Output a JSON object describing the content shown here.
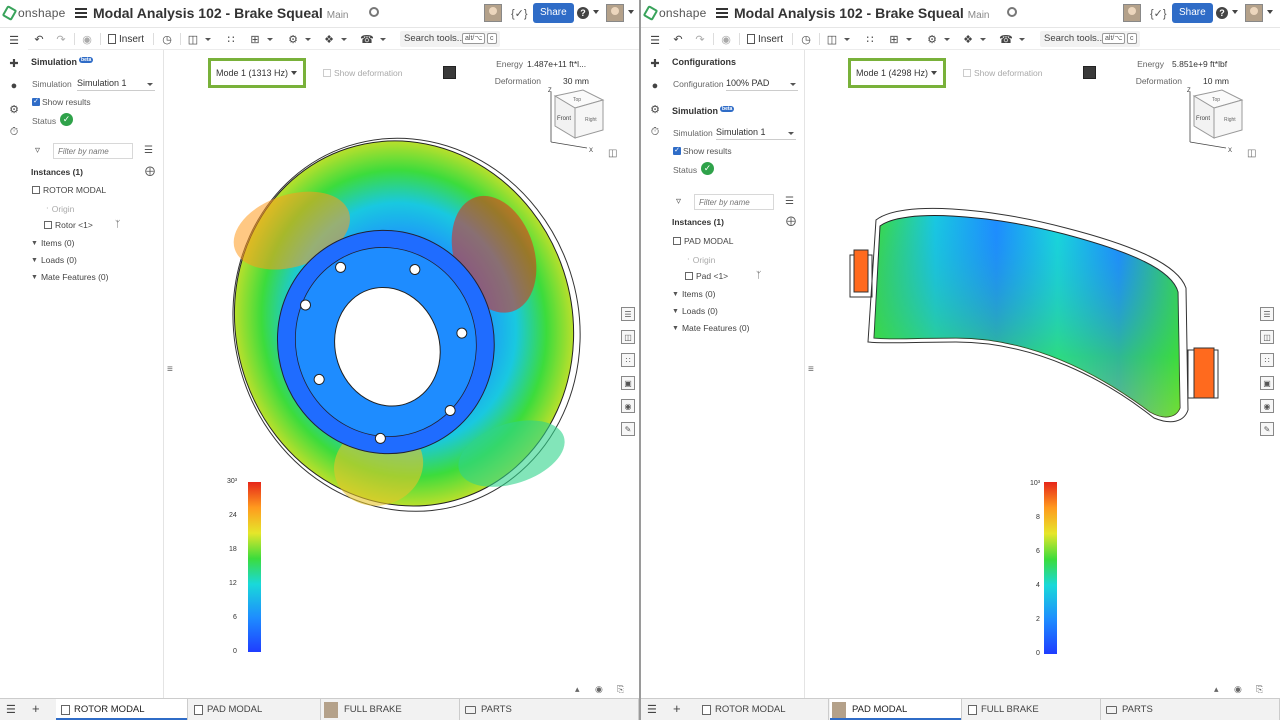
{
  "left": {
    "app_name": "onshape",
    "doc_title": "Modal Analysis 102 - Brake Squeal",
    "branch": "Main",
    "share_label": "Share",
    "curly_label": "{✓}",
    "toolbar": {
      "insert_label": "Insert",
      "search_label": "Search tools...",
      "search_kbd1": "alt/⌥",
      "search_kbd2": "c"
    },
    "panel": {
      "header": "Simulation",
      "beta": "beta",
      "simulation_label": "Simulation",
      "simulation_value": "Simulation 1",
      "show_results_label": "Show results",
      "status_label": "Status",
      "filter_placeholder": "Filter by name",
      "instances_label": "Instances (1)",
      "assembly_name": "ROTOR MODAL",
      "origin_label": "Origin",
      "part_label": "Rotor <1>",
      "items_label": "Items (0)",
      "loads_label": "Loads (0)",
      "mate_features_label": "Mate Features (0)"
    },
    "viewport": {
      "mode_label": "Mode 1 (1313 Hz)",
      "show_deformation_label": "Show deformation",
      "energy_label": "Energy",
      "energy_value": "1.487e+11 ft*l...",
      "deformation_label": "Deformation",
      "deformation_value": "30 mm",
      "scale_labels": [
        "30³",
        "24",
        "18",
        "12",
        "6",
        "0"
      ]
    },
    "tabs": [
      {
        "label": "ROTOR MODAL",
        "active": true
      },
      {
        "label": "PAD MODAL",
        "active": false
      },
      {
        "label": "FULL BRAKE",
        "active": false
      },
      {
        "label": "PARTS",
        "active": false
      }
    ]
  },
  "right": {
    "app_name": "onshape",
    "doc_title": "Modal Analysis 102 - Brake Squeal",
    "branch": "Main",
    "share_label": "Share",
    "curly_label": "{✓}",
    "toolbar": {
      "insert_label": "Insert",
      "search_label": "Search tools...",
      "search_kbd1": "alt/⌥",
      "search_kbd2": "c"
    },
    "panel": {
      "config_header": "Configurations",
      "configuration_label": "Configuration",
      "configuration_value": "100% PAD",
      "header": "Simulation",
      "beta": "beta",
      "simulation_label": "Simulation",
      "simulation_value": "Simulation 1",
      "show_results_label": "Show results",
      "status_label": "Status",
      "filter_placeholder": "Filter by name",
      "instances_label": "Instances (1)",
      "assembly_name": "PAD MODAL",
      "origin_label": "Origin",
      "part_label": "Pad <1>",
      "items_label": "Items (0)",
      "loads_label": "Loads (0)",
      "mate_features_label": "Mate Features (0)"
    },
    "viewport": {
      "mode_label": "Mode 1 (4298 Hz)",
      "show_deformation_label": "Show deformation",
      "energy_label": "Energy",
      "energy_value": "5.851e+9 ft*lbf",
      "deformation_label": "Deformation",
      "deformation_value": "10 mm",
      "scale_labels": [
        "10³",
        "8",
        "6",
        "4",
        "2",
        "0"
      ]
    },
    "tabs": [
      {
        "label": "ROTOR MODAL",
        "active": false
      },
      {
        "label": "PAD MODAL",
        "active": true
      },
      {
        "label": "FULL BRAKE",
        "active": false
      },
      {
        "label": "PARTS",
        "active": false
      }
    ]
  },
  "view_cube": {
    "top": "Top",
    "front": "Front",
    "right": "Right",
    "axis_x": "X",
    "axis_z": "Z"
  },
  "colors": {
    "accent": "#2f6cc7",
    "highlight": "#79b13a",
    "status_ok": "#2fa24a"
  },
  "icons": [
    "hamburger-icon",
    "link-icon",
    "help-icon",
    "undo-icon",
    "redo-icon",
    "filter-icon",
    "list-icon",
    "mate-connector-icon",
    "add-tab-icon",
    "tab-list-icon"
  ]
}
